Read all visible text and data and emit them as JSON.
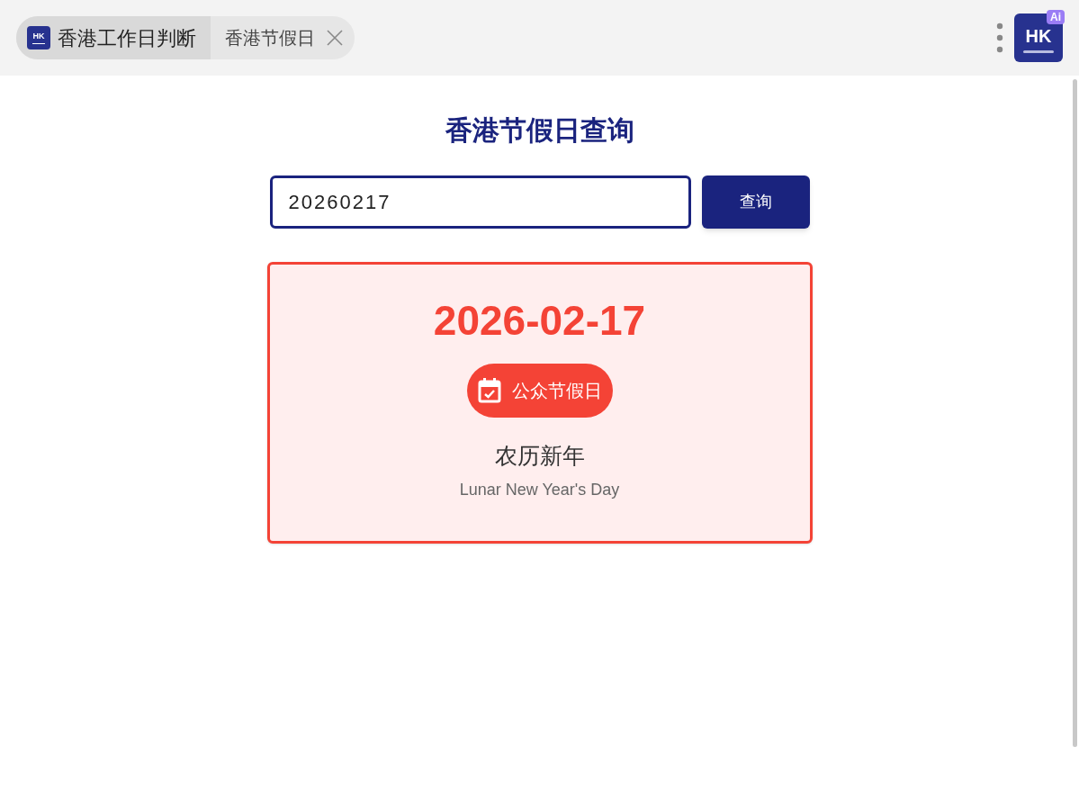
{
  "header": {
    "tabs": [
      {
        "label": "香港工作日判断",
        "logo_text": "HK",
        "selected": true,
        "closable": false
      },
      {
        "label": "香港节假日",
        "selected": false,
        "closable": true
      }
    ],
    "app_badge": {
      "text": "HK",
      "tag": "Ai"
    }
  },
  "title": "香港节假日查询",
  "search": {
    "value": "20260217",
    "button": "查询"
  },
  "result": {
    "date": "2026-02-17",
    "is_holiday": true,
    "badge": "公众节假日",
    "name": "农历新年",
    "name_en": "Lunar New Year's Day"
  }
}
